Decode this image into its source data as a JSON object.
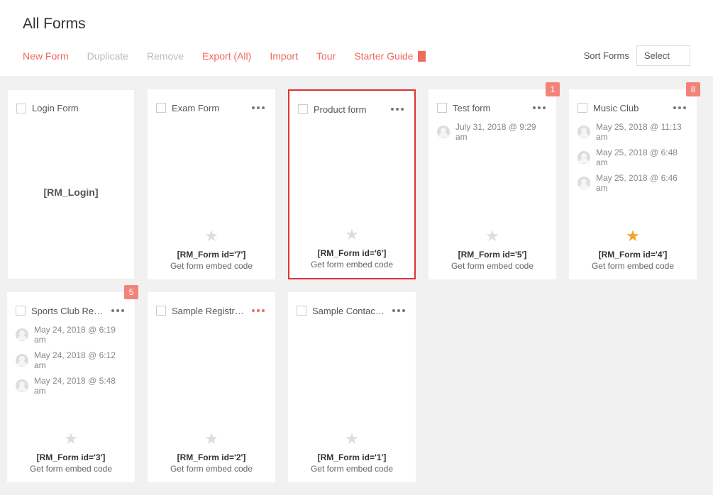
{
  "page_title": "All Forms",
  "toolbar": {
    "new_form": "New Form",
    "duplicate": "Duplicate",
    "remove": "Remove",
    "export": "Export (All)",
    "import": "Import",
    "tour": "Tour",
    "starter_guide": "Starter Guide"
  },
  "sort": {
    "label": "Sort Forms",
    "selected": "Select"
  },
  "cards": {
    "login": {
      "title": "Login Form",
      "code": "[RM_Login]"
    },
    "exam": {
      "title": "Exam Form",
      "shortcode": "[RM_Form id='7']",
      "embed": "Get form embed code"
    },
    "product": {
      "title": "Product form",
      "shortcode": "[RM_Form id='6']",
      "embed": "Get form embed code"
    },
    "test": {
      "title": "Test form",
      "badge": "1",
      "shortcode": "[RM_Form id='5']",
      "embed": "Get form embed code",
      "entries": [
        "July 31, 2018 @ 9:29 am"
      ]
    },
    "music": {
      "title": "Music Club",
      "badge": "8",
      "shortcode": "[RM_Form id='4']",
      "embed": "Get form embed code",
      "entries": [
        "May 25, 2018 @ 11:13 am",
        "May 25, 2018 @ 6:48 am",
        "May 25, 2018 @ 6:46 am"
      ]
    },
    "sports": {
      "title": "Sports Club Registrati...",
      "badge": "5",
      "shortcode": "[RM_Form id='3']",
      "embed": "Get form embed code",
      "entries": [
        "May 24, 2018 @ 6:19 am",
        "May 24, 2018 @ 6:12 am",
        "May 24, 2018 @ 5:48 am"
      ]
    },
    "samplereg": {
      "title": "Sample Registration ...",
      "shortcode": "[RM_Form id='2']",
      "embed": "Get form embed code"
    },
    "samplecontact": {
      "title": "Sample Contact Form",
      "shortcode": "[RM_Form id='1']",
      "embed": "Get form embed code"
    }
  }
}
